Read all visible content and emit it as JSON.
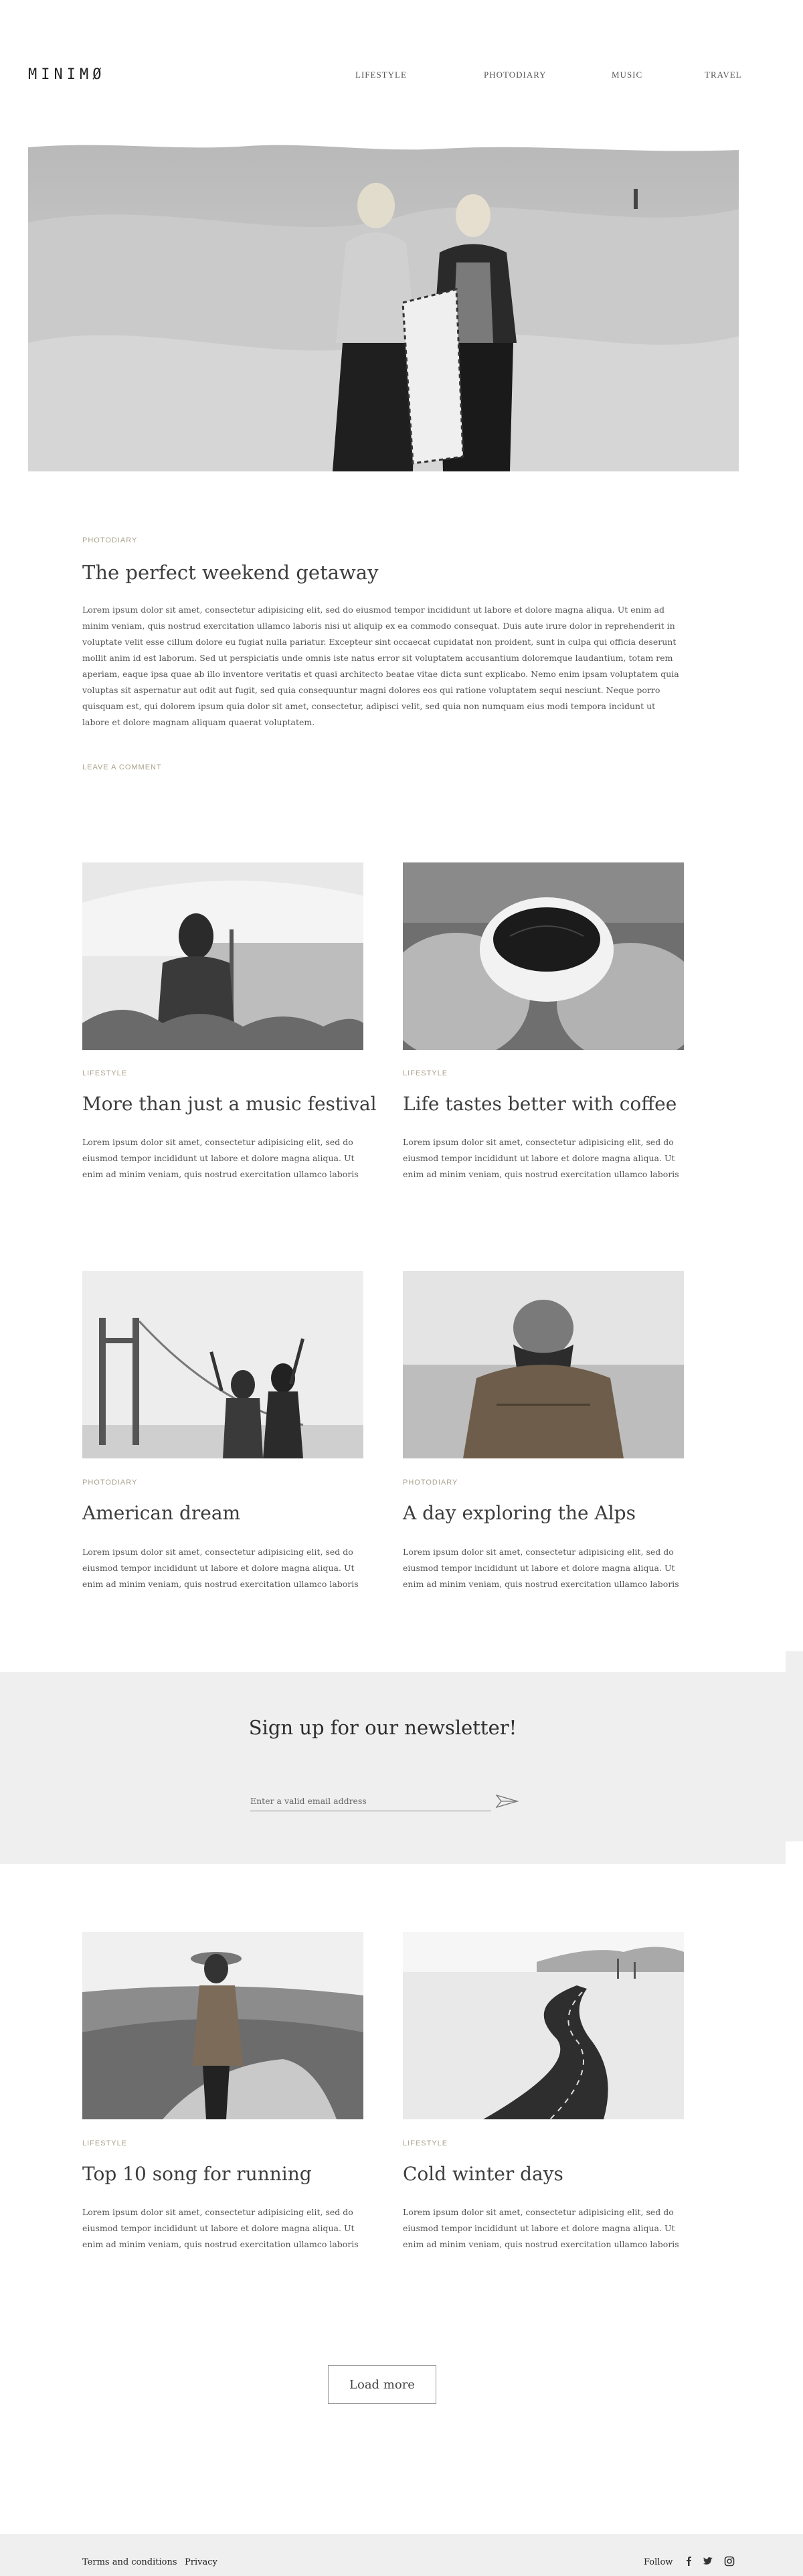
{
  "header": {
    "logo": "MINIMØ",
    "nav": [
      "LIFESTYLE",
      "PHOTODIARY",
      "MUSIC",
      "TRAVEL"
    ]
  },
  "hero": {
    "category": "PHOTODIARY",
    "title": "The perfect weekend getaway",
    "text": "Lorem ipsum dolor sit amet, consectetur adipisicing elit, sed do eiusmod tempor incididunt ut labore et dolore magna aliqua. Ut enim ad minim veniam, quis nostrud exercitation ullamco laboris nisi ut aliquip ex ea commodo consequat. Duis aute irure dolor in reprehenderit in voluptate velit esse cillum dolore eu fugiat nulla pariatur. Excepteur sint occaecat cupidatat non proident, sunt in culpa qui officia deserunt mollit anim id est laborum. Sed ut perspiciatis unde omnis iste natus error sit voluptatem accusantium doloremque laudantium, totam rem aperiam, eaque ipsa quae ab illo inventore veritatis et quasi architecto beatae vitae dicta sunt explicabo. Nemo enim ipsam voluptatem quia voluptas sit aspernatur aut odit aut fugit, sed quia consequuntur magni dolores eos qui ratione voluptatem sequi nesciunt. Neque porro quisquam est, qui dolorem ipsum quia dolor sit amet, consectetur, adipisci velit, sed quia non numquam eius modi tempora incidunt ut labore et dolore magnam aliquam quaerat voluptatem.",
    "leave_comment": "LEAVE A COMMENT"
  },
  "posts": [
    {
      "category": "LIFESTYLE",
      "title": "More than just a music festival",
      "text": "Lorem ipsum dolor sit amet, consectetur adipisicing elit, sed do eiusmod tempor incididunt ut labore et dolore magna aliqua. Ut enim ad minim veniam, quis nostrud exercitation ullamco laboris"
    },
    {
      "category": "LIFESTYLE",
      "title": "Life tastes better with coffee",
      "text": "Lorem ipsum dolor sit amet, consectetur adipisicing elit, sed do eiusmod tempor incididunt ut labore et dolore magna aliqua. Ut enim ad minim veniam, quis nostrud exercitation ullamco laboris"
    },
    {
      "category": "PHOTODIARY",
      "title": "American dream",
      "text": "Lorem ipsum dolor sit amet, consectetur adipisicing elit, sed do eiusmod tempor incididunt ut labore et dolore magna aliqua. Ut enim ad minim veniam, quis nostrud exercitation ullamco laboris"
    },
    {
      "category": "PHOTODIARY",
      "title": "A day exploring the Alps",
      "text": "Lorem ipsum dolor sit amet, consectetur adipisicing elit, sed do eiusmod tempor incididunt ut labore et dolore magna aliqua. Ut enim ad minim veniam, quis nostrud exercitation ullamco laboris"
    },
    {
      "category": "LIFESTYLE",
      "title": "Top 10 song for running",
      "text": "Lorem ipsum dolor sit amet, consectetur adipisicing elit, sed do eiusmod tempor incididunt ut labore et dolore magna aliqua. Ut enim ad minim veniam, quis nostrud exercitation ullamco laboris"
    },
    {
      "category": "LIFESTYLE",
      "title": "Cold winter days",
      "text": "Lorem ipsum dolor sit amet, consectetur adipisicing elit, sed do eiusmod tempor incididunt ut labore et dolore magna aliqua. Ut enim ad minim veniam, quis nostrud exercitation ullamco laboris"
    }
  ],
  "newsletter": {
    "title": "Sign up for our newsletter!",
    "placeholder": "Enter a valid email address",
    "send_icon": "paper-plane-icon"
  },
  "load_more": "Load more",
  "footer": {
    "terms": "Terms and conditions",
    "privacy": "Privacy",
    "follow": "Follow",
    "icons": [
      "facebook-icon",
      "twitter-icon",
      "instagram-icon"
    ]
  },
  "colors": {
    "category_accent": "#a9a18c",
    "band_gray": "#efefef",
    "text": "#3d3d3d"
  }
}
